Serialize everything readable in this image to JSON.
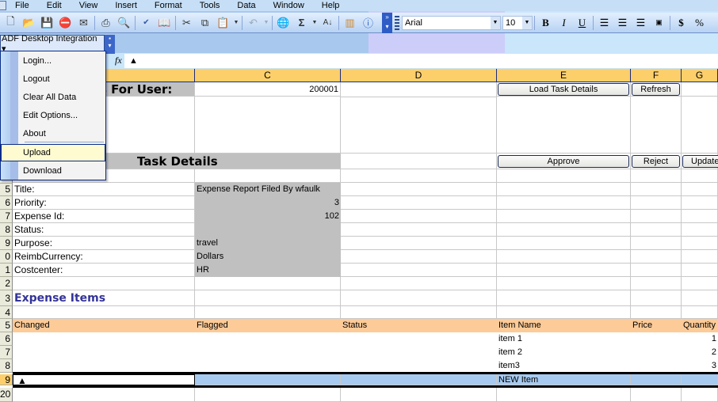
{
  "menubar": {
    "items": [
      "File",
      "Edit",
      "View",
      "Insert",
      "Format",
      "Tools",
      "Data",
      "Window",
      "Help"
    ]
  },
  "toolbar": {
    "standard_icons": [
      "new-icon",
      "open-icon",
      "save-icon",
      "permission-icon",
      "email-icon",
      "print-icon",
      "print-preview-icon",
      "spelling-icon",
      "research-icon",
      "cut-icon",
      "copy-icon",
      "paste-icon",
      "undo-icon",
      "hyperlink-icon",
      "autosum-icon",
      "sort-ascending-icon",
      "chart-wizard-icon",
      "help-icon"
    ],
    "font_name": "Arial",
    "font_size": "10",
    "format_buttons": [
      "B",
      "I",
      "U"
    ],
    "currency": "$",
    "percent": "%"
  },
  "adf": {
    "menu_label": "ADF Desktop Integration ▾",
    "items": [
      "Login...",
      "Logout",
      "Clear All Data",
      "Edit Options...",
      "About",
      "Upload",
      "Download"
    ],
    "highlighted": "Upload"
  },
  "formula_bar": {
    "fx": "fx",
    "content": "▲"
  },
  "columns": [
    "C",
    "D",
    "E",
    "F",
    "G"
  ],
  "sheet": {
    "tasks_header": "ks For User:",
    "user_id": "200001",
    "task_details_title": "Task Details",
    "buttons": {
      "load": "Load Task Details",
      "refresh": "Refresh",
      "approve": "Approve",
      "reject": "Reject",
      "update": "Update"
    },
    "details": [
      {
        "row": "5",
        "label": "Title:",
        "value": "Expense Report Filed By wfaulk",
        "align": "left"
      },
      {
        "row": "6",
        "label": "Priority:",
        "value": "3",
        "align": "right"
      },
      {
        "row": "7",
        "label": "Expense Id:",
        "value": "102",
        "align": "right"
      },
      {
        "row": "8",
        "label": "Status:",
        "value": "",
        "align": "left"
      },
      {
        "row": "9",
        "label": "Purpose:",
        "value": "travel",
        "align": "left"
      },
      {
        "row": "0",
        "label": "ReimbCurrency:",
        "value": "Dollars",
        "align": "left"
      },
      {
        "row": "1",
        "label": "Costcenter:",
        "value": "HR",
        "align": "left"
      }
    ],
    "expense_items_title": "Expense Items",
    "table_headers": [
      "Changed",
      "Flagged",
      "Status",
      "Item Name",
      "Price",
      "Quantity"
    ],
    "items": [
      {
        "row": "6",
        "name": "item 1",
        "qty": "1"
      },
      {
        "row": "7",
        "name": "item 2",
        "qty": "2"
      },
      {
        "row": "8",
        "name": "item3",
        "qty": "3"
      }
    ],
    "new_row": {
      "row": "9",
      "changed": "▲",
      "name": "NEW Item"
    },
    "row_labels": [
      "2",
      "3",
      "4",
      "5",
      "20"
    ]
  }
}
